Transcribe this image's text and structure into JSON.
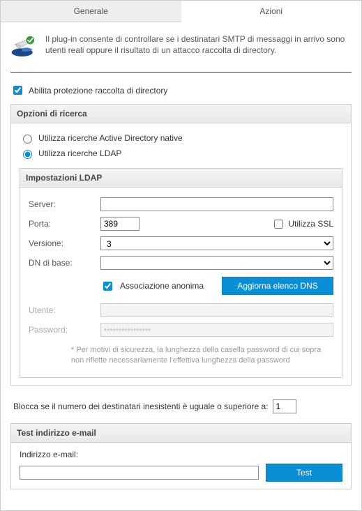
{
  "tabs": {
    "general": "Generale",
    "actions": "Azioni"
  },
  "intro": "Il plug-in consente di controllare se i destinatari SMTP di messaggi in arrivo sono utenti reali oppure il risultato di un attacco raccolta di directory.",
  "enable_label": "Abilita protezione raccolta di directory",
  "search": {
    "title": "Opzioni di ricerca",
    "radio_ad": "Utilizza ricerche Active Directory native",
    "radio_ldap": "Utilizza ricerche LDAP"
  },
  "ldap": {
    "title": "Impostazioni LDAP",
    "server_label": "Server:",
    "server_value": "",
    "port_label": "Porta:",
    "port_value": "389",
    "ssl_label": "Utilizza SSL",
    "version_label": "Versione:",
    "version_value": "3",
    "basedn_label": "DN di base:",
    "basedn_value": "",
    "anon_label": "Associazione anonima",
    "refresh_btn": "Aggiorna elenco DNS",
    "user_label": "Utente:",
    "user_value": "",
    "password_label": "Password:",
    "password_value": "••••••••••••••••",
    "note": "* Per motivi di sicurezza, la lunghezza della casella password di cui sopra non riflette necessariamente l'effettiva lunghezza della password"
  },
  "block": {
    "label": "Blocca se il numero dei destinatari inesistenti è uguale o superiore a:",
    "value": "1"
  },
  "test": {
    "title": "Test indirizzo e-mail",
    "field_label": "Indirizzo e-mail:",
    "field_value": "",
    "button": "Test"
  }
}
